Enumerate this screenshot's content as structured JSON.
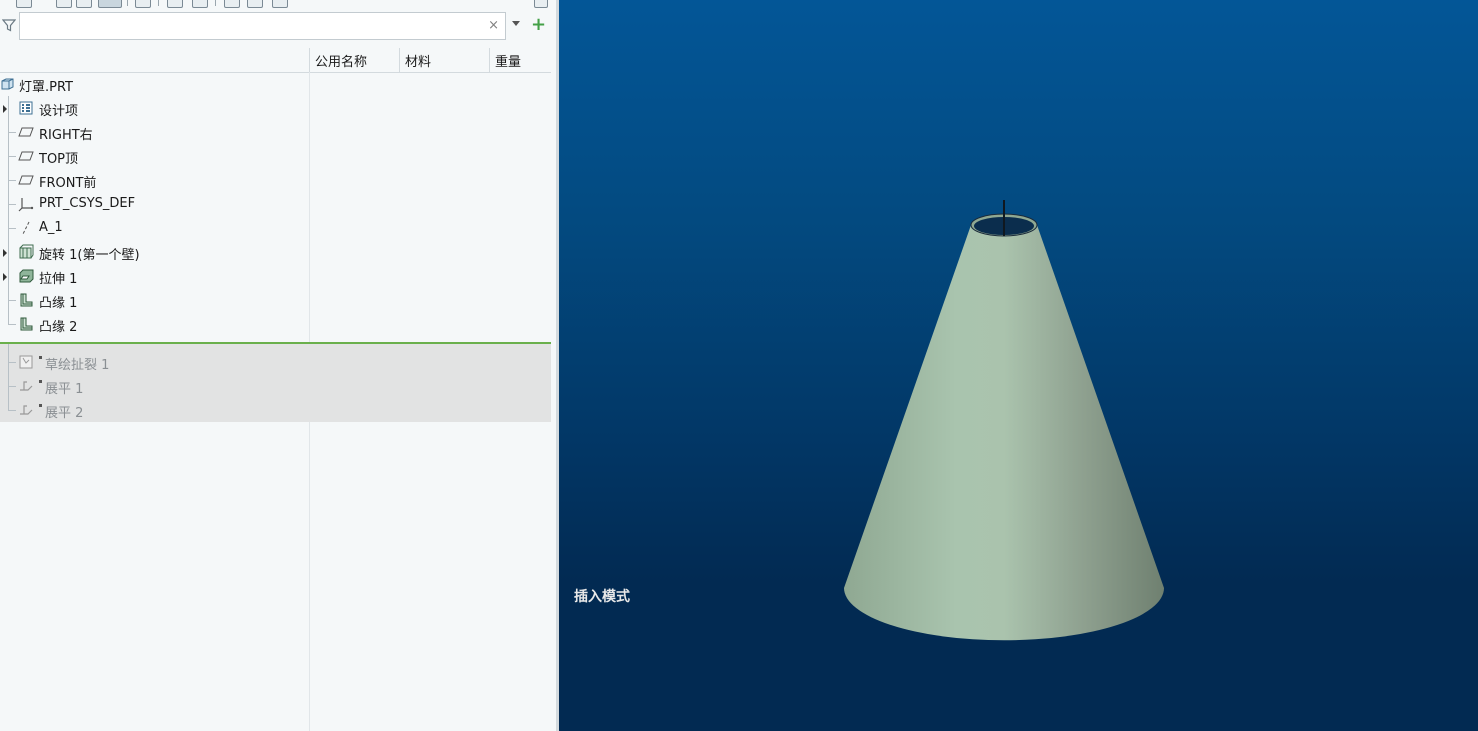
{
  "search": {
    "value": "",
    "placeholder": "",
    "clear_glyph": "×"
  },
  "columns": {
    "name": "公用名称",
    "material": "材料",
    "weight": "重量"
  },
  "tree": {
    "root": {
      "label": "灯罩.PRT",
      "icon": "part-icon"
    },
    "items": [
      {
        "label": "设计项",
        "icon": "design-items-icon",
        "expandable": true
      },
      {
        "label": "RIGHT右",
        "icon": "datum-plane-icon",
        "expandable": false
      },
      {
        "label": "TOP顶",
        "icon": "datum-plane-icon",
        "expandable": false
      },
      {
        "label": "FRONT前",
        "icon": "datum-plane-icon",
        "expandable": false
      },
      {
        "label": "PRT_CSYS_DEF",
        "icon": "coordinate-system-icon",
        "expandable": false
      },
      {
        "label": "A_1",
        "icon": "datum-axis-icon",
        "expandable": false
      },
      {
        "label": "旋转 1(第一个壁)",
        "icon": "revolve-icon",
        "expandable": true
      },
      {
        "label": "拉伸 1",
        "icon": "extrude-icon",
        "expandable": true
      },
      {
        "label": "凸缘 1",
        "icon": "flange-icon",
        "expandable": false
      },
      {
        "label": "凸缘 2",
        "icon": "flange-icon",
        "expandable": false
      }
    ],
    "suppressed_items": [
      {
        "label": "草绘扯裂 1",
        "icon": "sketched-rip-icon"
      },
      {
        "label": "展平 1",
        "icon": "unbend-icon"
      },
      {
        "label": "展平 2",
        "icon": "unbend-icon"
      }
    ]
  },
  "viewport": {
    "mode_label": "插入模式",
    "colors": {
      "bg_top": "#035697",
      "bg_bottom": "#022a52",
      "model": "#9fb8a4",
      "insert_line": "#6ab04c"
    }
  }
}
